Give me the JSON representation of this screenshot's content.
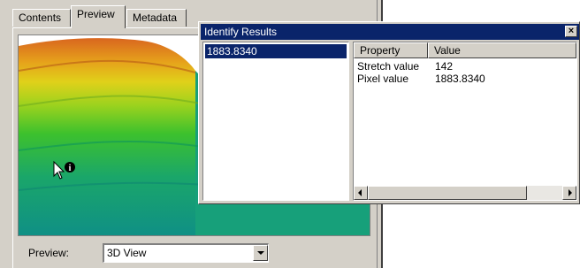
{
  "catalog": {
    "tabs": [
      {
        "label": "Contents",
        "active": false
      },
      {
        "label": "Preview",
        "active": true
      },
      {
        "label": "Metadata",
        "active": false
      }
    ],
    "preview_label": "Preview:",
    "preview_select": {
      "selected": "3D View"
    },
    "view_icon": "identify-cursor-icon"
  },
  "identify": {
    "title": "Identify Results",
    "close_label": "×",
    "results": [
      "1883.8340"
    ],
    "columns": [
      "Property",
      "Value"
    ],
    "rows": [
      {
        "property": "Stretch value",
        "value": "142"
      },
      {
        "property": "Pixel value",
        "value": "1883.8340"
      }
    ]
  },
  "colors": {
    "titlebar": "#0a246a",
    "dialog_face": "#d4d0c8",
    "selection": "#0a246a"
  }
}
